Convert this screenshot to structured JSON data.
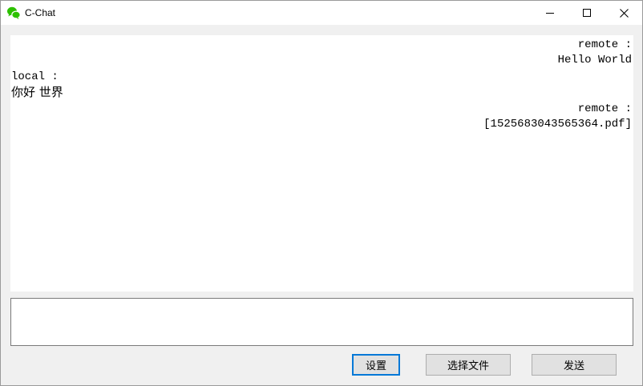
{
  "window": {
    "title": "C-Chat",
    "icon": "wechat-bubbles-icon",
    "accent_color": "#2dc100"
  },
  "messages": [
    {
      "sender": "remote :",
      "text": "Hello World",
      "side": "right"
    },
    {
      "sender": "local :",
      "text": "你好 世界",
      "side": "left"
    },
    {
      "sender": "remote :",
      "text": "[1525683043565364.pdf]",
      "side": "right"
    }
  ],
  "input": {
    "value": ""
  },
  "buttons": {
    "settings_label": "设置",
    "file_label": "选择文件",
    "send_label": "发送"
  }
}
